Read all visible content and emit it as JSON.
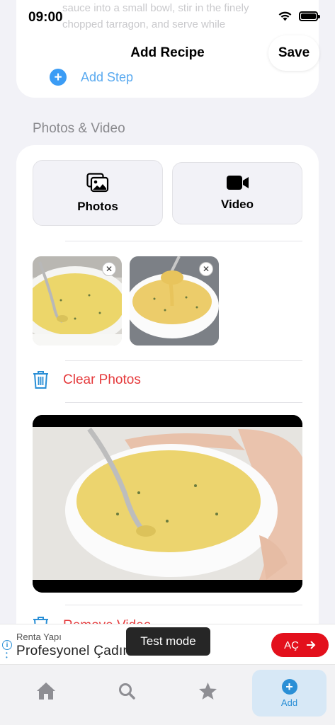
{
  "status_bar": {
    "time": "09:00"
  },
  "background_step_text": "sauce into a small bowl, stir in the finely\nchopped tarragon, and serve while",
  "nav": {
    "title": "Add Recipe",
    "save_label": "Save"
  },
  "steps": {
    "add_step_label": "Add Step"
  },
  "media": {
    "section_title": "Photos & Video",
    "photos_button": "Photos",
    "video_button": "Video",
    "clear_photos_label": "Clear Photos",
    "remove_video_label": "Remove Video",
    "photos_count": 2
  },
  "ad": {
    "advertiser": "Renta Yapı",
    "headline": "Profesyonel Çadır",
    "cta": "AÇ",
    "toast": "Test mode"
  },
  "tabs": [
    {
      "name": "home",
      "icon": "house-icon",
      "label": ""
    },
    {
      "name": "search",
      "icon": "magnifier-icon",
      "label": ""
    },
    {
      "name": "favorites",
      "icon": "star-icon",
      "label": ""
    },
    {
      "name": "add",
      "icon": "plus-circle-icon",
      "label": "Add"
    }
  ],
  "colors": {
    "accent": "#2a8fd6",
    "destructive": "#e5393b",
    "ad_cta": "#e3101c",
    "background": "#f2f2f7"
  }
}
